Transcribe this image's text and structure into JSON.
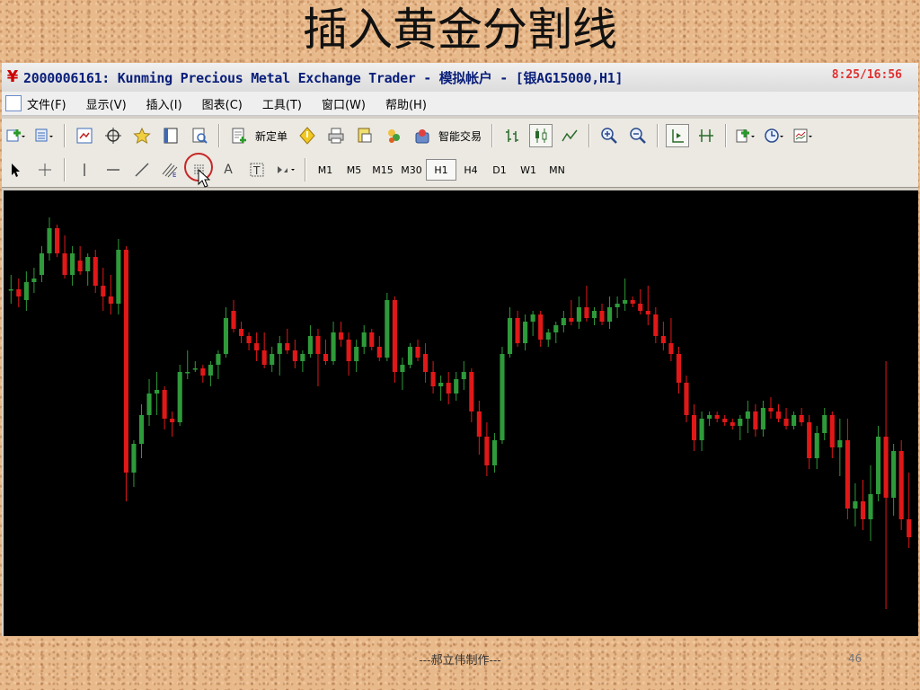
{
  "slide": {
    "title": "插入黄金分割线",
    "footer": "---郝立伟制作---",
    "page_number": "46"
  },
  "window": {
    "title": "2000006161: Kunming Precious Metal Exchange Trader - 模拟帐户 - [银AG15000,H1]",
    "time_display": "8:25/16:56"
  },
  "menu": {
    "items": [
      "文件(F)",
      "显示(V)",
      "插入(I)",
      "图表(C)",
      "工具(T)",
      "窗口(W)",
      "帮助(H)"
    ]
  },
  "toolbar": {
    "new_order_label": "新定单",
    "smart_trade_label": "智能交易"
  },
  "timeframes": [
    "M1",
    "M5",
    "M15",
    "M30",
    "H1",
    "H4",
    "D1",
    "W1",
    "MN"
  ],
  "active_timeframe": "H1",
  "colors": {
    "bull_candle": "#2e9a3a",
    "bear_candle": "#e01818",
    "chart_background": "#000000",
    "highlight_ring": "#c82828"
  },
  "chart_data": {
    "type": "candlestick",
    "symbol": "银AG15000",
    "timeframe": "H1",
    "candles": [
      {
        "o": 3.8,
        "h": 4.2,
        "l": 3.4,
        "c": 3.8
      },
      {
        "o": 3.8,
        "h": 4.1,
        "l": 3.3,
        "c": 3.6
      },
      {
        "o": 3.5,
        "h": 4.3,
        "l": 3.2,
        "c": 4.0
      },
      {
        "o": 4.0,
        "h": 4.4,
        "l": 3.7,
        "c": 4.1
      },
      {
        "o": 4.2,
        "h": 5.0,
        "l": 4.0,
        "c": 4.8
      },
      {
        "o": 4.8,
        "h": 5.8,
        "l": 4.6,
        "c": 5.5
      },
      {
        "o": 5.5,
        "h": 5.6,
        "l": 4.7,
        "c": 4.8
      },
      {
        "o": 4.8,
        "h": 5.3,
        "l": 4.1,
        "c": 4.2
      },
      {
        "o": 4.2,
        "h": 5.0,
        "l": 3.9,
        "c": 4.8
      },
      {
        "o": 4.6,
        "h": 5.0,
        "l": 4.2,
        "c": 4.3
      },
      {
        "o": 4.3,
        "h": 4.8,
        "l": 3.9,
        "c": 4.7
      },
      {
        "o": 4.7,
        "h": 4.9,
        "l": 3.7,
        "c": 3.9
      },
      {
        "o": 3.9,
        "h": 4.4,
        "l": 3.2,
        "c": 3.6
      },
      {
        "o": 3.6,
        "h": 4.2,
        "l": 3.1,
        "c": 3.4
      },
      {
        "o": 3.4,
        "h": 5.2,
        "l": 3.1,
        "c": 4.9
      },
      {
        "o": 4.9,
        "h": 5.0,
        "l": -2.1,
        "c": -1.3
      },
      {
        "o": -1.3,
        "h": -0.4,
        "l": -1.7,
        "c": -0.5
      },
      {
        "o": -0.5,
        "h": 0.6,
        "l": -0.9,
        "c": 0.3
      },
      {
        "o": 0.3,
        "h": 1.3,
        "l": 0.0,
        "c": 0.9
      },
      {
        "o": 0.9,
        "h": 1.5,
        "l": 0.3,
        "c": 1.0
      },
      {
        "o": 1.0,
        "h": 1.1,
        "l": -0.1,
        "c": 0.2
      },
      {
        "o": 0.2,
        "h": 0.4,
        "l": -0.3,
        "c": 0.1
      },
      {
        "o": 0.1,
        "h": 1.7,
        "l": 0.0,
        "c": 1.5
      },
      {
        "o": 1.5,
        "h": 2.1,
        "l": 1.3,
        "c": 1.5
      },
      {
        "o": 1.6,
        "h": 1.8,
        "l": 1.5,
        "c": 1.6
      },
      {
        "o": 1.6,
        "h": 1.7,
        "l": 1.2,
        "c": 1.4
      },
      {
        "o": 1.4,
        "h": 1.8,
        "l": 1.1,
        "c": 1.7
      },
      {
        "o": 1.7,
        "h": 2.1,
        "l": 1.3,
        "c": 2.0
      },
      {
        "o": 2.0,
        "h": 3.3,
        "l": 1.9,
        "c": 3.0
      },
      {
        "o": 3.2,
        "h": 3.5,
        "l": 2.6,
        "c": 2.7
      },
      {
        "o": 2.7,
        "h": 2.9,
        "l": 2.3,
        "c": 2.5
      },
      {
        "o": 2.5,
        "h": 2.6,
        "l": 2.1,
        "c": 2.3
      },
      {
        "o": 2.3,
        "h": 2.6,
        "l": 1.8,
        "c": 2.1
      },
      {
        "o": 2.1,
        "h": 2.6,
        "l": 1.6,
        "c": 1.7
      },
      {
        "o": 1.7,
        "h": 2.2,
        "l": 1.5,
        "c": 2.0
      },
      {
        "o": 2.0,
        "h": 2.5,
        "l": 1.4,
        "c": 2.3
      },
      {
        "o": 2.3,
        "h": 2.7,
        "l": 2.0,
        "c": 2.1
      },
      {
        "o": 2.1,
        "h": 2.4,
        "l": 1.6,
        "c": 1.8
      },
      {
        "o": 1.8,
        "h": 2.1,
        "l": 1.5,
        "c": 2.0
      },
      {
        "o": 2.0,
        "h": 2.8,
        "l": 1.9,
        "c": 2.5
      },
      {
        "o": 2.5,
        "h": 2.7,
        "l": 1.1,
        "c": 2.0
      },
      {
        "o": 2.0,
        "h": 2.4,
        "l": 1.7,
        "c": 1.8
      },
      {
        "o": 1.8,
        "h": 2.9,
        "l": 1.7,
        "c": 2.6
      },
      {
        "o": 2.6,
        "h": 2.9,
        "l": 2.2,
        "c": 2.4
      },
      {
        "o": 2.4,
        "h": 2.6,
        "l": 1.4,
        "c": 1.8
      },
      {
        "o": 1.8,
        "h": 2.4,
        "l": 1.5,
        "c": 2.2
      },
      {
        "o": 2.2,
        "h": 2.8,
        "l": 2.0,
        "c": 2.6
      },
      {
        "o": 2.6,
        "h": 2.7,
        "l": 2.1,
        "c": 2.2
      },
      {
        "o": 2.2,
        "h": 2.5,
        "l": 1.8,
        "c": 1.9
      },
      {
        "o": 1.9,
        "h": 3.7,
        "l": 1.8,
        "c": 3.5
      },
      {
        "o": 3.5,
        "h": 3.6,
        "l": 1.2,
        "c": 1.5
      },
      {
        "o": 1.5,
        "h": 1.9,
        "l": 1.0,
        "c": 1.7
      },
      {
        "o": 1.7,
        "h": 2.3,
        "l": 1.6,
        "c": 2.2
      },
      {
        "o": 2.2,
        "h": 2.4,
        "l": 1.8,
        "c": 1.9
      },
      {
        "o": 2.0,
        "h": 2.3,
        "l": 1.2,
        "c": 1.5
      },
      {
        "o": 1.5,
        "h": 1.8,
        "l": 0.9,
        "c": 1.1
      },
      {
        "o": 1.1,
        "h": 1.4,
        "l": 0.7,
        "c": 1.2
      },
      {
        "o": 1.2,
        "h": 1.5,
        "l": 0.6,
        "c": 0.9
      },
      {
        "o": 0.9,
        "h": 1.5,
        "l": 0.7,
        "c": 1.3
      },
      {
        "o": 1.3,
        "h": 1.8,
        "l": 1.0,
        "c": 1.5
      },
      {
        "o": 1.5,
        "h": 1.6,
        "l": 0.1,
        "c": 0.4
      },
      {
        "o": 0.4,
        "h": 0.7,
        "l": -0.8,
        "c": -0.3
      },
      {
        "o": -0.3,
        "h": 0.1,
        "l": -1.4,
        "c": -1.1
      },
      {
        "o": -1.1,
        "h": -0.2,
        "l": -1.3,
        "c": -0.4
      },
      {
        "o": -0.4,
        "h": 2.2,
        "l": -0.5,
        "c": 2.0
      },
      {
        "o": 2.0,
        "h": 3.3,
        "l": 1.9,
        "c": 3.0
      },
      {
        "o": 3.0,
        "h": 3.2,
        "l": 2.2,
        "c": 2.3
      },
      {
        "o": 2.3,
        "h": 3.1,
        "l": 2.1,
        "c": 2.9
      },
      {
        "o": 2.9,
        "h": 3.2,
        "l": 2.5,
        "c": 3.1
      },
      {
        "o": 3.1,
        "h": 3.2,
        "l": 2.2,
        "c": 2.4
      },
      {
        "o": 2.4,
        "h": 2.7,
        "l": 2.2,
        "c": 2.6
      },
      {
        "o": 2.6,
        "h": 2.9,
        "l": 2.3,
        "c": 2.8
      },
      {
        "o": 2.8,
        "h": 3.2,
        "l": 2.6,
        "c": 3.0
      },
      {
        "o": 3.0,
        "h": 3.5,
        "l": 2.8,
        "c": 2.9
      },
      {
        "o": 2.9,
        "h": 3.6,
        "l": 2.7,
        "c": 3.3
      },
      {
        "o": 3.3,
        "h": 3.9,
        "l": 2.9,
        "c": 3.0
      },
      {
        "o": 3.0,
        "h": 3.3,
        "l": 2.8,
        "c": 3.2
      },
      {
        "o": 3.2,
        "h": 3.4,
        "l": 2.8,
        "c": 2.9
      },
      {
        "o": 2.9,
        "h": 3.6,
        "l": 2.7,
        "c": 3.3
      },
      {
        "o": 3.3,
        "h": 3.6,
        "l": 3.0,
        "c": 3.4
      },
      {
        "o": 3.4,
        "h": 4.1,
        "l": 3.2,
        "c": 3.5
      },
      {
        "o": 3.5,
        "h": 3.6,
        "l": 3.3,
        "c": 3.4
      },
      {
        "o": 3.4,
        "h": 3.8,
        "l": 3.1,
        "c": 3.2
      },
      {
        "o": 3.2,
        "h": 3.9,
        "l": 2.8,
        "c": 3.1
      },
      {
        "o": 3.1,
        "h": 3.3,
        "l": 2.3,
        "c": 2.5
      },
      {
        "o": 2.5,
        "h": 2.9,
        "l": 2.1,
        "c": 2.3
      },
      {
        "o": 2.3,
        "h": 3.0,
        "l": 1.8,
        "c": 2.0
      },
      {
        "o": 2.0,
        "h": 2.2,
        "l": 0.9,
        "c": 1.2
      },
      {
        "o": 1.2,
        "h": 1.4,
        "l": 0.1,
        "c": 0.3
      },
      {
        "o": 0.3,
        "h": 0.6,
        "l": -0.7,
        "c": -0.4
      },
      {
        "o": -0.4,
        "h": 0.4,
        "l": -0.7,
        "c": 0.2
      },
      {
        "o": 0.2,
        "h": 0.4,
        "l": 0.0,
        "c": 0.3
      },
      {
        "o": 0.3,
        "h": 0.4,
        "l": 0.1,
        "c": 0.2
      },
      {
        "o": 0.2,
        "h": 0.3,
        "l": 0.0,
        "c": 0.1
      },
      {
        "o": 0.1,
        "h": 0.2,
        "l": -0.1,
        "c": 0.0
      },
      {
        "o": 0.0,
        "h": 0.3,
        "l": -0.4,
        "c": 0.2
      },
      {
        "o": 0.2,
        "h": 0.7,
        "l": -0.2,
        "c": 0.4
      },
      {
        "o": 0.4,
        "h": 0.6,
        "l": -0.3,
        "c": -0.1
      },
      {
        "o": -0.1,
        "h": 0.7,
        "l": -0.3,
        "c": 0.5
      },
      {
        "o": 0.5,
        "h": 0.8,
        "l": 0.2,
        "c": 0.4
      },
      {
        "o": 0.4,
        "h": 0.6,
        "l": 0.1,
        "c": 0.2
      },
      {
        "o": 0.2,
        "h": 0.5,
        "l": -0.1,
        "c": 0.0
      },
      {
        "o": 0.0,
        "h": 0.4,
        "l": -0.1,
        "c": 0.3
      },
      {
        "o": 0.3,
        "h": 0.5,
        "l": 0.0,
        "c": 0.1
      },
      {
        "o": 0.1,
        "h": 0.3,
        "l": -1.2,
        "c": -0.9
      },
      {
        "o": -0.9,
        "h": 0.0,
        "l": -1.2,
        "c": -0.2
      },
      {
        "o": -0.2,
        "h": 0.5,
        "l": -0.4,
        "c": 0.3
      },
      {
        "o": 0.3,
        "h": 0.4,
        "l": -0.9,
        "c": -0.6
      },
      {
        "o": -0.6,
        "h": 0.2,
        "l": -1.4,
        "c": -0.4
      },
      {
        "o": -0.4,
        "h": 0.2,
        "l": -2.6,
        "c": -2.3
      },
      {
        "o": -2.3,
        "h": -1.6,
        "l": -2.8,
        "c": -2.1
      },
      {
        "o": -2.1,
        "h": -1.5,
        "l": -2.9,
        "c": -2.6
      },
      {
        "o": -2.6,
        "h": -1.1,
        "l": -3.2,
        "c": -1.9
      },
      {
        "o": -1.9,
        "h": 0.0,
        "l": -2.1,
        "c": -0.3
      },
      {
        "o": -0.3,
        "h": 1.8,
        "l": -5.1,
        "c": -2.0
      },
      {
        "o": -2.0,
        "h": -0.5,
        "l": -2.5,
        "c": -0.7
      },
      {
        "o": -0.7,
        "h": -0.4,
        "l": -2.9,
        "c": -2.6
      },
      {
        "o": -2.6,
        "h": -1.3,
        "l": -3.4,
        "c": -3.1
      }
    ]
  }
}
